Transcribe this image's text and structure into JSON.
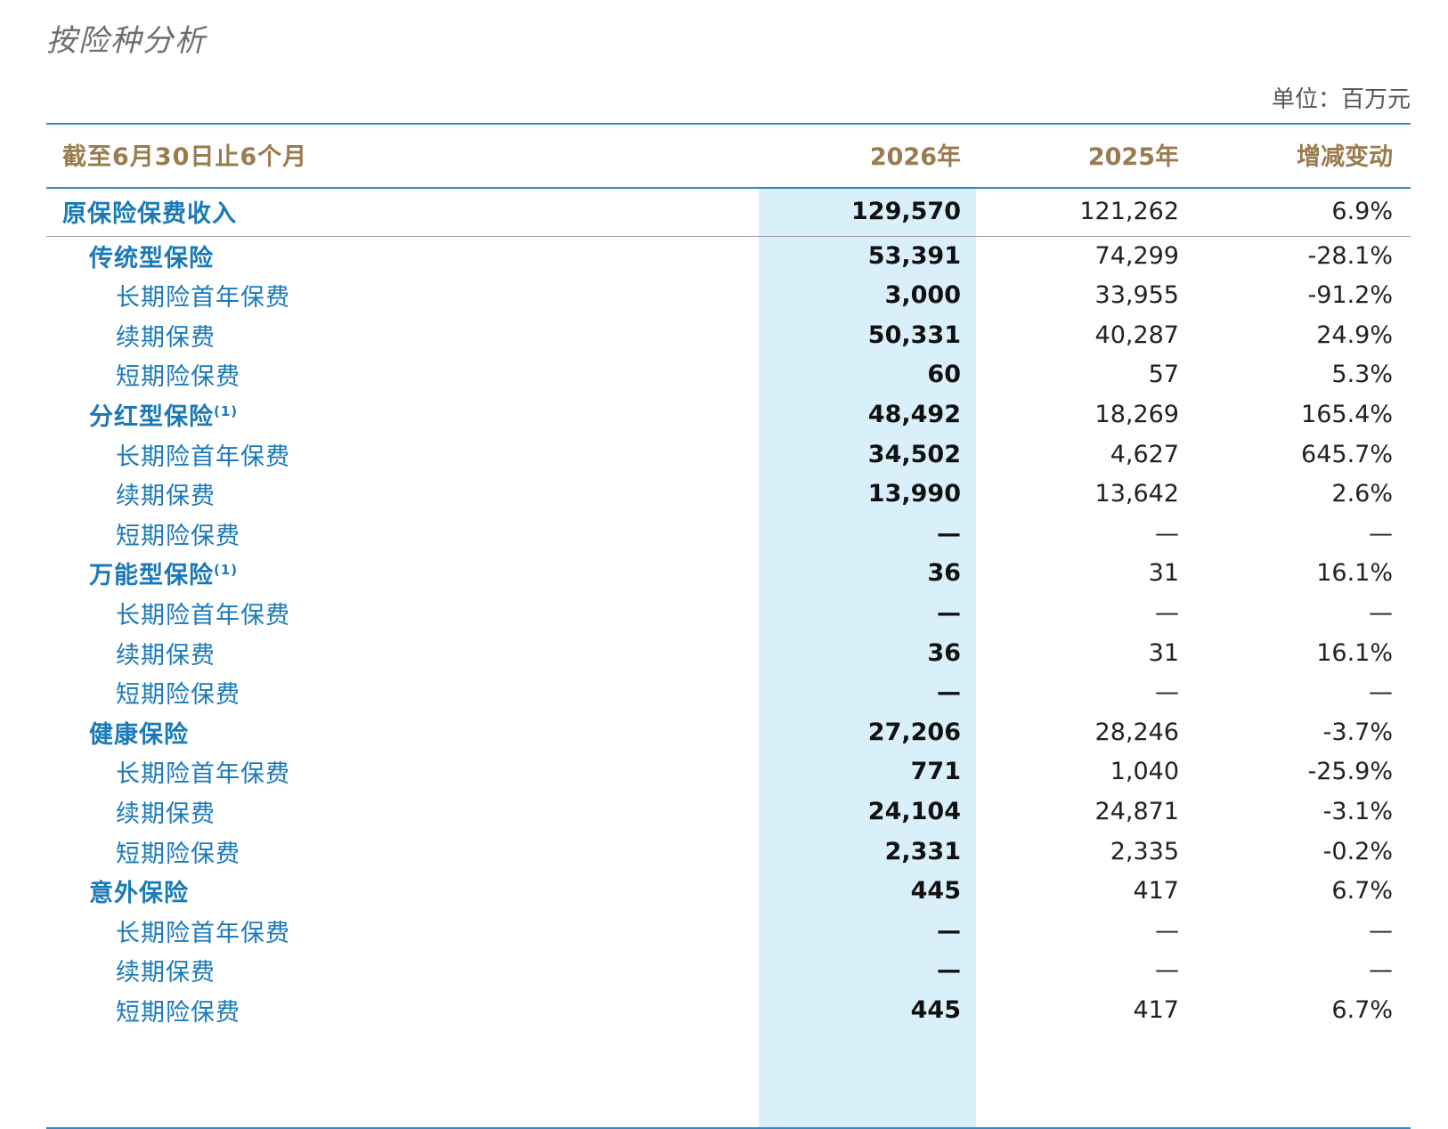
{
  "title": "按险种分析",
  "unit": "单位：百万元",
  "header": {
    "period": "截至6月30日止6个月",
    "col1": "2026年",
    "col2": "2025年",
    "col3": "增减变动"
  },
  "rows": [
    {
      "label": "原保险保费收入",
      "note": "",
      "level": 0,
      "v2026": "129,570",
      "v2025": "121,262",
      "change": "6.9%"
    },
    {
      "label": "传统型保险",
      "note": "",
      "level": 1,
      "v2026": "53,391",
      "v2025": "74,299",
      "change": "-28.1%"
    },
    {
      "label": "长期险首年保费",
      "note": "",
      "level": 2,
      "v2026": "3,000",
      "v2025": "33,955",
      "change": "-91.2%"
    },
    {
      "label": "续期保费",
      "note": "",
      "level": 2,
      "v2026": "50,331",
      "v2025": "40,287",
      "change": "24.9%"
    },
    {
      "label": "短期险保费",
      "note": "",
      "level": 2,
      "v2026": "60",
      "v2025": "57",
      "change": "5.3%"
    },
    {
      "label": "分红型保险",
      "note": "(1)",
      "level": 1,
      "v2026": "48,492",
      "v2025": "18,269",
      "change": "165.4%"
    },
    {
      "label": "长期险首年保费",
      "note": "",
      "level": 2,
      "v2026": "34,502",
      "v2025": "4,627",
      "change": "645.7%"
    },
    {
      "label": "续期保费",
      "note": "",
      "level": 2,
      "v2026": "13,990",
      "v2025": "13,642",
      "change": "2.6%"
    },
    {
      "label": "短期险保费",
      "note": "",
      "level": 2,
      "v2026": "—",
      "v2025": "—",
      "change": "—"
    },
    {
      "label": "万能型保险",
      "note": "(1)",
      "level": 1,
      "v2026": "36",
      "v2025": "31",
      "change": "16.1%"
    },
    {
      "label": "长期险首年保费",
      "note": "",
      "level": 2,
      "v2026": "—",
      "v2025": "—",
      "change": "—"
    },
    {
      "label": "续期保费",
      "note": "",
      "level": 2,
      "v2026": "36",
      "v2025": "31",
      "change": "16.1%"
    },
    {
      "label": "短期险保费",
      "note": "",
      "level": 2,
      "v2026": "—",
      "v2025": "—",
      "change": "—"
    },
    {
      "label": "健康保险",
      "note": "",
      "level": 1,
      "v2026": "27,206",
      "v2025": "28,246",
      "change": "-3.7%"
    },
    {
      "label": "长期险首年保费",
      "note": "",
      "level": 2,
      "v2026": "771",
      "v2025": "1,040",
      "change": "-25.9%"
    },
    {
      "label": "续期保费",
      "note": "",
      "level": 2,
      "v2026": "24,104",
      "v2025": "24,871",
      "change": "-3.1%"
    },
    {
      "label": "短期险保费",
      "note": "",
      "level": 2,
      "v2026": "2,331",
      "v2025": "2,335",
      "change": "-0.2%"
    },
    {
      "label": "意外保险",
      "note": "",
      "level": 1,
      "v2026": "445",
      "v2025": "417",
      "change": "6.7%"
    },
    {
      "label": "长期险首年保费",
      "note": "",
      "level": 2,
      "v2026": "—",
      "v2025": "—",
      "change": "—"
    },
    {
      "label": "续期保费",
      "note": "",
      "level": 2,
      "v2026": "—",
      "v2025": "—",
      "change": "—"
    },
    {
      "label": "短期险保费",
      "note": "",
      "level": 2,
      "v2026": "445",
      "v2025": "417",
      "change": "6.7%"
    }
  ]
}
